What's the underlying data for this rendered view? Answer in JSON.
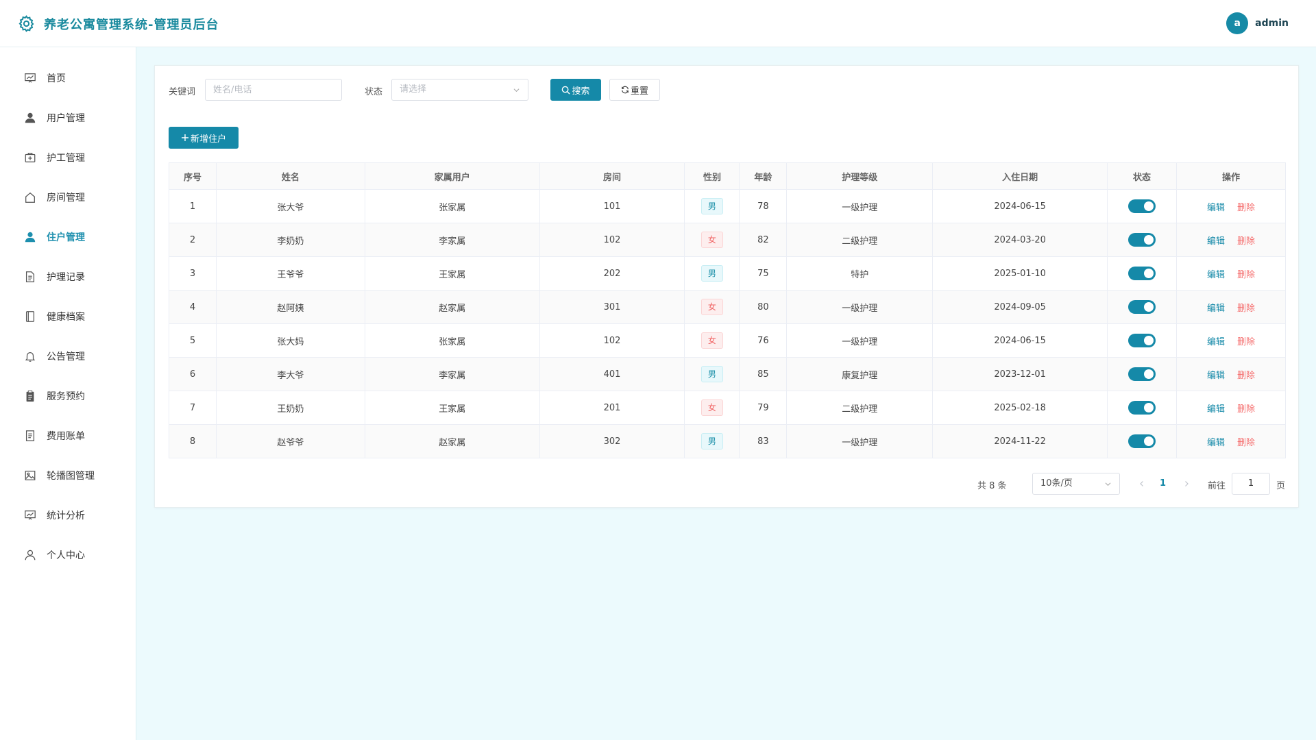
{
  "header": {
    "title": "养老公寓管理系统-管理员后台",
    "avatar_letter": "a",
    "username": "admin"
  },
  "sidebar": {
    "items": [
      {
        "label": "首页",
        "icon": "home-chart-icon"
      },
      {
        "label": "用户管理",
        "icon": "user-icon"
      },
      {
        "label": "护工管理",
        "icon": "medical-box-icon"
      },
      {
        "label": "房间管理",
        "icon": "house-icon"
      },
      {
        "label": "住户管理",
        "icon": "user-icon",
        "active": true
      },
      {
        "label": "护理记录",
        "icon": "document-icon"
      },
      {
        "label": "健康档案",
        "icon": "notebook-icon"
      },
      {
        "label": "公告管理",
        "icon": "bell-icon"
      },
      {
        "label": "服务预约",
        "icon": "clipboard-icon"
      },
      {
        "label": "费用账单",
        "icon": "receipt-icon"
      },
      {
        "label": "轮播图管理",
        "icon": "picture-icon"
      },
      {
        "label": "统计分析",
        "icon": "chart-board-icon"
      },
      {
        "label": "个人中心",
        "icon": "user-outline-icon"
      }
    ]
  },
  "filters": {
    "keyword_label": "关键词",
    "keyword_placeholder": "姓名/电话",
    "status_label": "状态",
    "status_placeholder": "请选择",
    "search_label": "搜索",
    "reset_label": "重置",
    "add_label": "新增住户"
  },
  "table": {
    "headers": [
      "序号",
      "姓名",
      "家属用户",
      "房间",
      "性别",
      "年龄",
      "护理等级",
      "入住日期",
      "状态",
      "操作"
    ],
    "edit_label": "编辑",
    "delete_label": "删除",
    "rows": [
      {
        "no": "1",
        "name": "张大爷",
        "family": "张家属",
        "room": "101",
        "gender": "男",
        "age": "78",
        "level": "一级护理",
        "date": "2024-06-15",
        "status": "on"
      },
      {
        "no": "2",
        "name": "李奶奶",
        "family": "李家属",
        "room": "102",
        "gender": "女",
        "age": "82",
        "level": "二级护理",
        "date": "2024-03-20",
        "status": "on"
      },
      {
        "no": "3",
        "name": "王爷爷",
        "family": "王家属",
        "room": "202",
        "gender": "男",
        "age": "75",
        "level": "特护",
        "date": "2025-01-10",
        "status": "on"
      },
      {
        "no": "4",
        "name": "赵阿姨",
        "family": "赵家属",
        "room": "301",
        "gender": "女",
        "age": "80",
        "level": "一级护理",
        "date": "2024-09-05",
        "status": "on"
      },
      {
        "no": "5",
        "name": "张大妈",
        "family": "张家属",
        "room": "102",
        "gender": "女",
        "age": "76",
        "level": "一级护理",
        "date": "2024-06-15",
        "status": "on"
      },
      {
        "no": "6",
        "name": "李大爷",
        "family": "李家属",
        "room": "401",
        "gender": "男",
        "age": "85",
        "level": "康复护理",
        "date": "2023-12-01",
        "status": "on"
      },
      {
        "no": "7",
        "name": "王奶奶",
        "family": "王家属",
        "room": "201",
        "gender": "女",
        "age": "79",
        "level": "二级护理",
        "date": "2025-02-18",
        "status": "on"
      },
      {
        "no": "8",
        "name": "赵爷爷",
        "family": "赵家属",
        "room": "302",
        "gender": "男",
        "age": "83",
        "level": "一级护理",
        "date": "2024-11-22",
        "status": "on"
      }
    ]
  },
  "pagination": {
    "total_text": "共 8 条",
    "page_size": "10条/页",
    "current_page": "1",
    "goto_label": "前往",
    "goto_value": "1",
    "page_suffix": "页"
  },
  "colors": {
    "primary": "#1589a8",
    "danger": "#f56c6c",
    "background": "#ecfafd"
  }
}
